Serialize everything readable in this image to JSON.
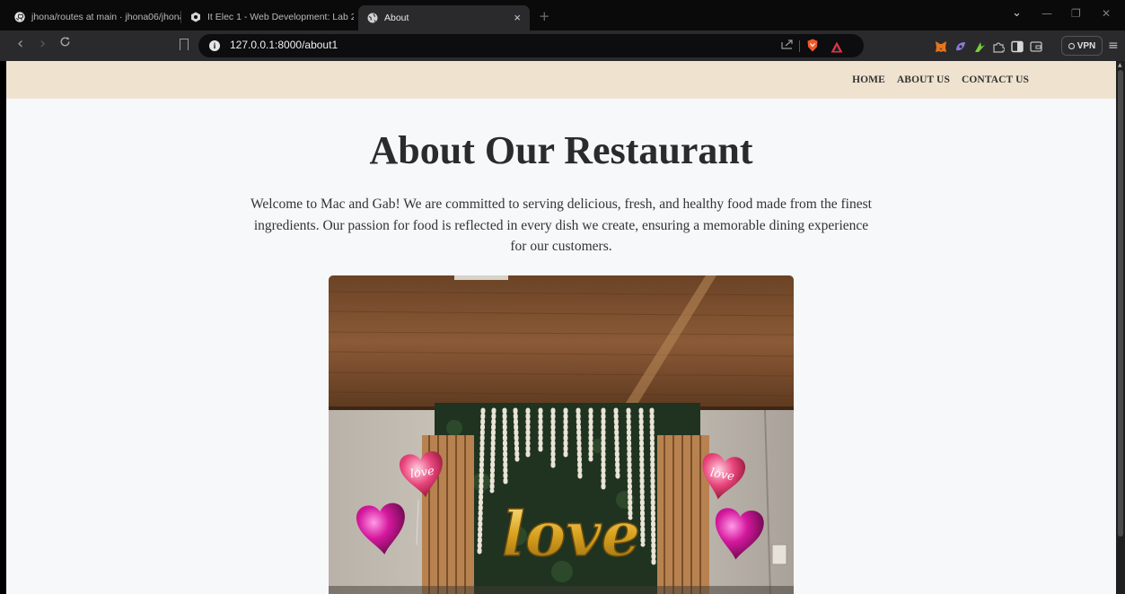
{
  "browser": {
    "tabs": [
      {
        "title": "jhona/routes at main · jhona06/jhona",
        "icon": "github-icon"
      },
      {
        "title": "It Elec 1 - Web Development: Lab 2",
        "icon": "course-icon"
      },
      {
        "title": "About",
        "icon": "globe-icon",
        "active": true
      }
    ],
    "tab_close": "×",
    "new_tab": "+",
    "window_controls": {
      "dropdown": "⌄",
      "minimize": "—",
      "restore": "❐",
      "close": "✕"
    },
    "nav": {
      "back": "‹",
      "forward": "›",
      "reload": "C"
    },
    "address": {
      "url": "127.0.0.1:8000/about1",
      "info": "i"
    },
    "vpn_label": "VPN",
    "menu": "≡"
  },
  "site": {
    "nav": [
      "HOME",
      "ABOUT US",
      "CONTACT US"
    ],
    "title": "About Our Restaurant",
    "intro": "Welcome to Mac and Gab! We are committed to serving delicious, fresh, and healthy food made from the finest ingredients. Our passion for food is reflected in every dish we create, ensuring a memorable dining experience for our customers.",
    "photo_text": "love",
    "balloon_text": "love"
  },
  "colors": {
    "nav_bg": "#efe3d0",
    "page_bg": "#f7f8fa",
    "chrome_bg": "#2a2a2d",
    "tabstrip_bg": "#0a0a0a"
  }
}
